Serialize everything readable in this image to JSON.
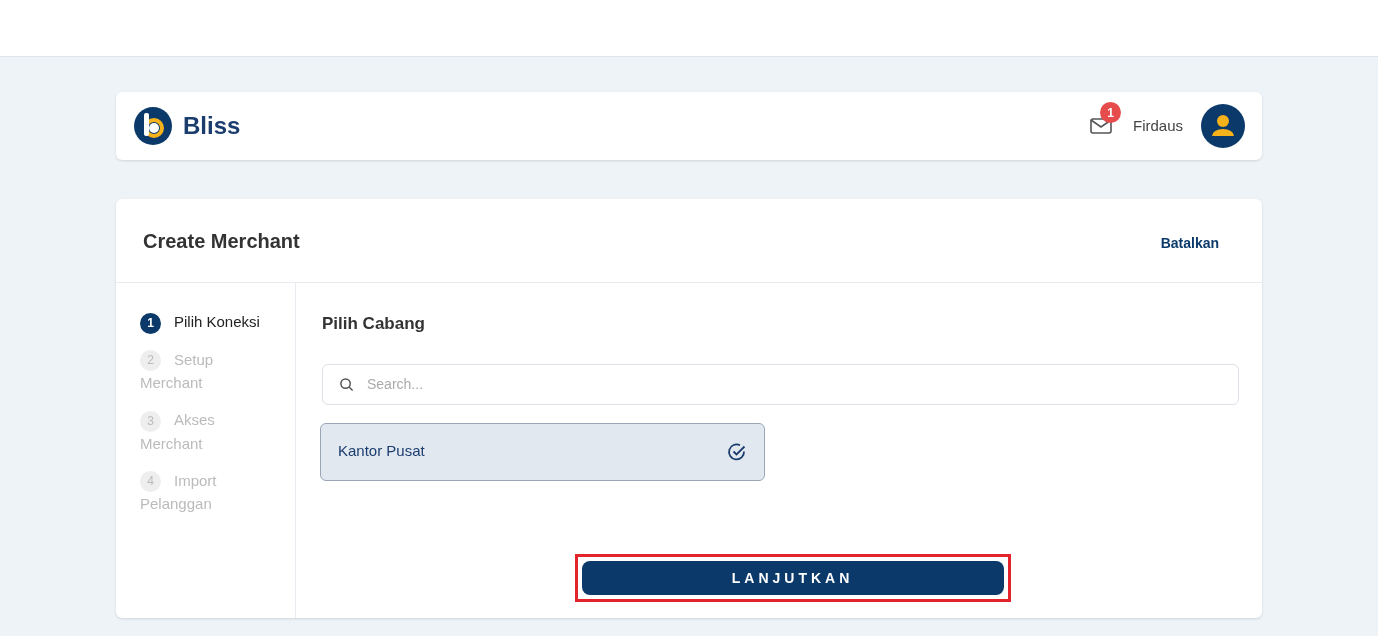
{
  "header": {
    "brand": "Bliss",
    "notifications": "1",
    "user": "Firdaus"
  },
  "card": {
    "title": "Create Merchant",
    "cancel": "Batalkan"
  },
  "steps": [
    {
      "number": "1",
      "label": "Pilih Koneksi",
      "selected": true
    },
    {
      "number": "2",
      "label": "Setup Merchant",
      "selected": false
    },
    {
      "number": "3",
      "label": "Akses Merchant",
      "selected": false
    },
    {
      "number": "4",
      "label": "Import Pelanggan",
      "selected": false
    }
  ],
  "section": {
    "title": "Pilih Cabang",
    "search": {
      "placeholder": "Search..."
    },
    "branches": [
      {
        "name": "Kantor Pusat",
        "selected": true
      }
    ]
  },
  "submit": {
    "label": "LANJUTKAN",
    "highlighted": true
  }
}
